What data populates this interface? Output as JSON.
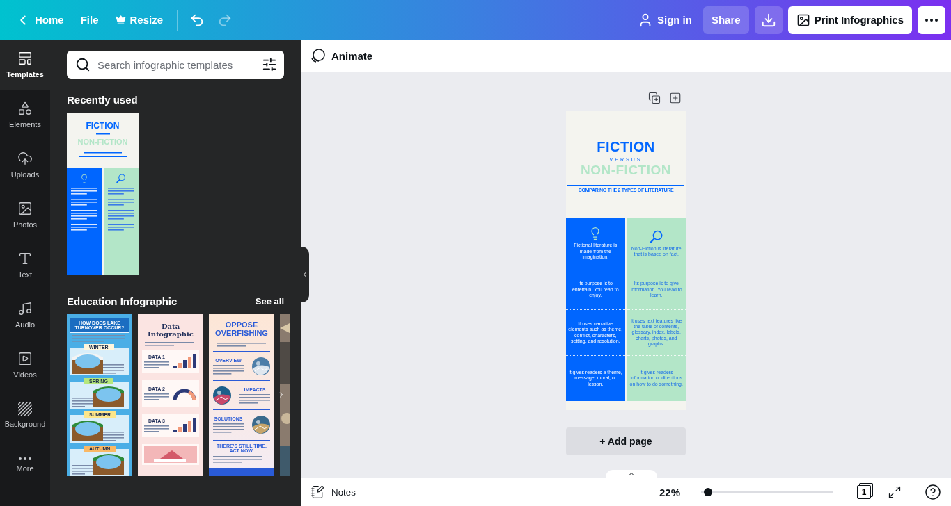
{
  "topbar": {
    "home": "Home",
    "file": "File",
    "resize": "Resize",
    "undo": {
      "disabled": false
    },
    "redo": {
      "disabled": true
    },
    "sign_in": "Sign in",
    "share": "Share",
    "print": "Print Infographics"
  },
  "rail": [
    {
      "kind": "templates",
      "label": "Templates",
      "selected": true
    },
    {
      "kind": "elements",
      "label": "Elements",
      "selected": false
    },
    {
      "kind": "uploads",
      "label": "Uploads",
      "selected": false
    },
    {
      "kind": "photos",
      "label": "Photos",
      "selected": false
    },
    {
      "kind": "text",
      "label": "Text",
      "selected": false
    },
    {
      "kind": "audio",
      "label": "Audio",
      "selected": false
    },
    {
      "kind": "videos",
      "label": "Videos",
      "selected": false
    },
    {
      "kind": "background",
      "label": "Background",
      "selected": false
    },
    {
      "kind": "more",
      "label": "More",
      "selected": false
    }
  ],
  "panel": {
    "search": {
      "placeholder": "Search infographic templates"
    },
    "recent": {
      "heading": "Recently used",
      "templates": [
        {
          "title": "FICTION",
          "subtitle": "NON-FICTION",
          "columns": [
            {
              "kind": "fiction",
              "color": "#0066ff"
            },
            {
              "kind": "nonfiction",
              "color": "#b3e6c8"
            }
          ]
        }
      ]
    },
    "section": {
      "heading": "Education Infographic",
      "link": "See all",
      "templates": [
        {
          "kind": "lake",
          "title": "HOW DOES LAKE TURNOVER OCCUR?",
          "seasons": [
            {
              "label": "WINTER",
              "color": "#fff6dc"
            },
            {
              "label": "SPRING",
              "color": "#b6e77c"
            },
            {
              "label": "SUMMER",
              "color": "#fde68a"
            },
            {
              "label": "AUTUMN",
              "color": "#f9b864"
            }
          ]
        },
        {
          "kind": "data",
          "title": "Data Infographic",
          "sections": [
            "DATA 1",
            "DATA 2",
            "DATA 3"
          ]
        },
        {
          "kind": "overfishing",
          "title": "OPPOSE OVERFISHING",
          "sections": [
            "OVERVIEW",
            "IMPACTS",
            "SOLUTIONS"
          ],
          "closing": "THERE'S STILL TIME. ACT NOW."
        },
        {
          "kind": "partial"
        }
      ]
    }
  },
  "editor": {
    "animate": "Animate",
    "page": {
      "title": "FICTION",
      "versus": "VERSUS",
      "subtitle": "NON-FICTION",
      "caption": "COMPARING THE 2 TYPES OF LITERATURE",
      "columns": [
        {
          "kind": "fiction",
          "color": "#0066ff",
          "cells": [
            "Fictional literature is made from the imagination.",
            "Its purpose is to entertain. You read to enjoy.",
            "It uses narrative elements such as theme, conflict, characters, setting, and resolution.",
            "It gives readers a theme, message, moral, or lesson."
          ]
        },
        {
          "kind": "nonfiction",
          "color": "#b3e6c8",
          "cells": [
            "Non-Fiction is literature that is based on fact.",
            "Its purpose is to give information. You read to learn.",
            "It uses text features like the table of contents, glossary, index, labels, charts, photos, and graphs.",
            "It gives readers information or directions on how to do something."
          ]
        }
      ]
    },
    "add_page": "+ Add page"
  },
  "bottom": {
    "notes": "Notes",
    "zoom": "22%",
    "zoom_slider": {
      "level": 0.02
    },
    "pages": "1"
  }
}
